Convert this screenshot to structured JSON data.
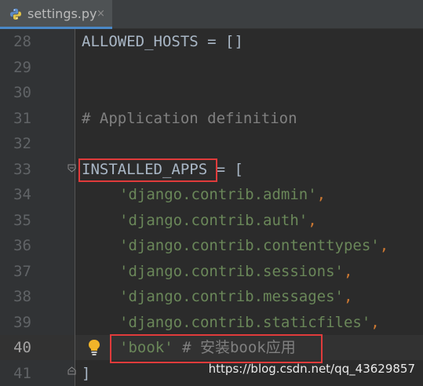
{
  "tab": {
    "icon": "python-file-icon",
    "label": "settings.py",
    "close_glyph": "×"
  },
  "lines": [
    {
      "num": "28",
      "text": "ALLOWED_HOSTS = []"
    },
    {
      "num": "29",
      "text": ""
    },
    {
      "num": "30",
      "text": ""
    },
    {
      "num": "31",
      "text": "# Application definition"
    },
    {
      "num": "32",
      "text": ""
    },
    {
      "num": "33",
      "name": "INSTALLED_APPS",
      "rest": " = ["
    },
    {
      "num": "34",
      "str": "'django.contrib.admin'",
      "comma": ","
    },
    {
      "num": "35",
      "str": "'django.contrib.auth'",
      "comma": ","
    },
    {
      "num": "36",
      "str": "'django.contrib.contenttypes'",
      "comma": ","
    },
    {
      "num": "37",
      "str": "'django.contrib.sessions'",
      "comma": ","
    },
    {
      "num": "38",
      "str": "'django.contrib.messages'",
      "comma": ","
    },
    {
      "num": "39",
      "str": "'django.contrib.staticfiles'",
      "comma": ","
    },
    {
      "num": "40",
      "str": "'book'",
      "comment": " # 安装book应用"
    },
    {
      "num": "41",
      "text": "]"
    }
  ],
  "watermark": "https://blog.csdn.net/qq_43629857",
  "colors": {
    "background": "#2b2b2b",
    "gutter": "#313335",
    "identifier": "#a9b7c6",
    "string": "#6a8759",
    "comment": "#808080",
    "highlight_box": "#e03b3b"
  }
}
